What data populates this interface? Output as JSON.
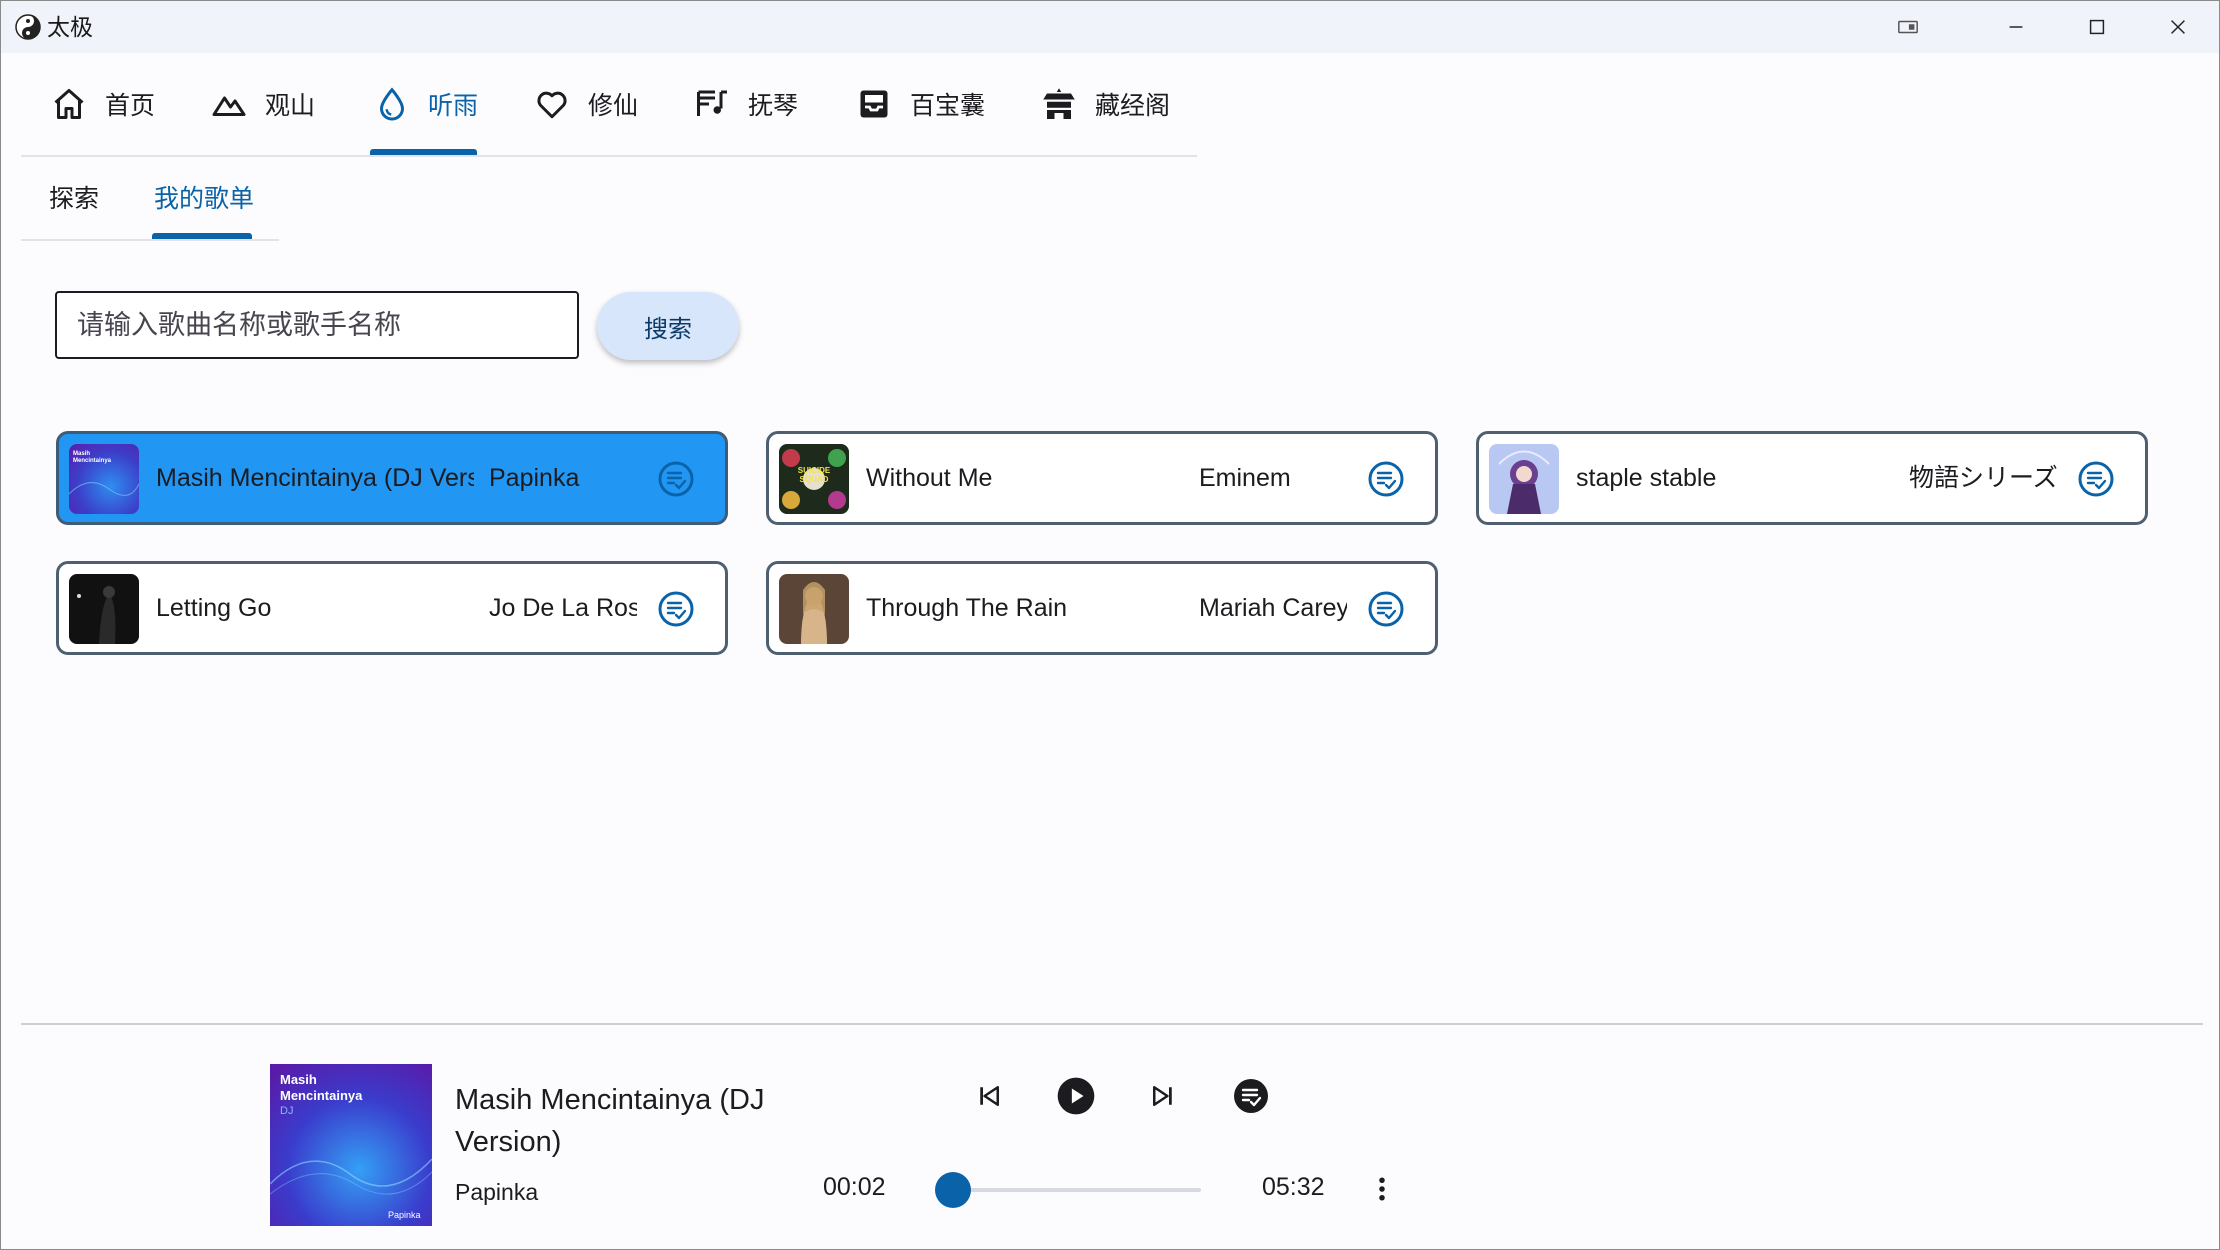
{
  "window": {
    "title": "太极",
    "controls": [
      "snap-icon",
      "minimize-icon",
      "maximize-icon",
      "close-icon"
    ]
  },
  "nav": {
    "active_index": 2,
    "items": [
      {
        "label": "首页",
        "icon": "home-icon"
      },
      {
        "label": "观山",
        "icon": "mountain-icon"
      },
      {
        "label": "听雨",
        "icon": "water-drop-icon"
      },
      {
        "label": "修仙",
        "icon": "heart-icon"
      },
      {
        "label": "抚琴",
        "icon": "music-note-icon"
      },
      {
        "label": "百宝囊",
        "icon": "inbox-icon"
      },
      {
        "label": "藏经阁",
        "icon": "temple-icon"
      }
    ]
  },
  "subtabs": {
    "active_index": 1,
    "items": [
      "探索",
      "我的歌单"
    ]
  },
  "search": {
    "placeholder": "请输入歌曲名称或歌手名称",
    "value": "",
    "button_label": "搜索"
  },
  "songs": [
    {
      "title": "Masih Mencintainya (DJ Version)",
      "artist": "Papinka",
      "selected": true
    },
    {
      "title": "Without Me",
      "artist": "Eminem",
      "selected": false
    },
    {
      "title": "staple stable",
      "artist": "物語シリーズ",
      "selected": false
    },
    {
      "title": "Letting Go",
      "artist": "Jo De La Rosa",
      "selected": false
    },
    {
      "title": "Through The Rain",
      "artist": "Mariah Carey",
      "selected": false
    }
  ],
  "player": {
    "title": "Masih Mencintainya (DJ Version)",
    "artist": "Papinka",
    "cover_text_line1": "Masih",
    "cover_text_line2": "Mencintainya",
    "cover_text_line3": "DJ",
    "cover_brand": "Papinka",
    "current_time": "00:02",
    "total_time": "05:32",
    "progress": 0.006
  },
  "colors": {
    "accent": "#0a63a8",
    "selected_card": "#2196f3",
    "card_border": "#4e6070",
    "search_button": "#d8e6fb"
  }
}
